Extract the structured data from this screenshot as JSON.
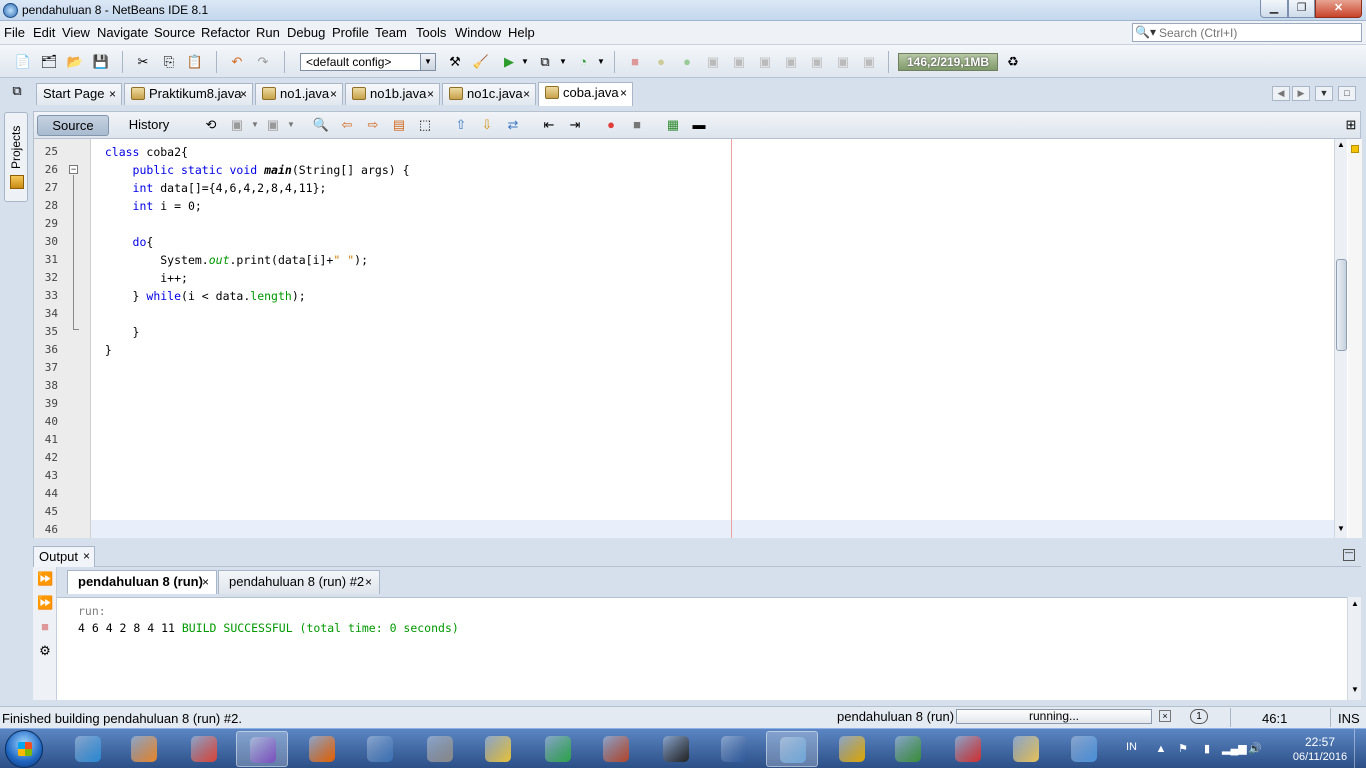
{
  "window": {
    "title": "pendahuluan 8 - NetBeans IDE 8.1"
  },
  "menu": [
    "File",
    "Edit",
    "View",
    "Navigate",
    "Source",
    "Refactor",
    "Run",
    "Debug",
    "Profile",
    "Team",
    "Tools",
    "Window",
    "Help"
  ],
  "search": {
    "placeholder": "Search (Ctrl+I)"
  },
  "toolbar": {
    "config": "<default config>",
    "memory": "146,2/219,1MB"
  },
  "editor_tabs": [
    {
      "label": "Start Page",
      "icon": "none"
    },
    {
      "label": "Praktikum8.java",
      "icon": "java-file-icon"
    },
    {
      "label": "no1.java",
      "icon": "java-file-icon"
    },
    {
      "label": "no1b.java",
      "icon": "java-file-icon"
    },
    {
      "label": "no1c.java",
      "icon": "java-file-icon"
    },
    {
      "label": "coba.java",
      "icon": "java-file-icon",
      "active": true
    }
  ],
  "projects_label": "Projects",
  "editor": {
    "source_tab": "Source",
    "history_tab": "History",
    "line_numbers": [
      "25",
      "26",
      "27",
      "28",
      "29",
      "30",
      "31",
      "32",
      "33",
      "34",
      "35",
      "36",
      "37",
      "38",
      "39",
      "40",
      "41",
      "42",
      "43",
      "44",
      "45",
      "46"
    ],
    "code": {
      "l25_kw": "class",
      "l25_rest": " coba2{",
      "l26_kw": "public static void",
      "l26_name": "main",
      "l26_rest": "(String[] args) {",
      "l27_kw": "int",
      "l27_rest": " data[]={4,6,4,2,8,4,11};",
      "l28_kw": "int",
      "l28_rest": " i = 0;",
      "l30_kw": "do",
      "l30_rest": "{",
      "l31_a": "System.",
      "l31_out": "out",
      "l31_b": ".print(data[i]+",
      "l31_str": "\" \"",
      "l31_c": ");",
      "l32": "i++;",
      "l33_a": "} ",
      "l33_kw": "while",
      "l33_b": "(i < data.",
      "l33_fld": "length",
      "l33_c": ");",
      "l35": "}",
      "l36": "}"
    }
  },
  "output": {
    "tab_label": "Output",
    "run_tabs": [
      "pendahuluan 8 (run)",
      "pendahuluan 8 (run) #2"
    ],
    "lines": {
      "run": "run:",
      "result": "4 6 4 2 8 4 11 ",
      "build": "BUILD SUCCESSFUL (total time: 0 seconds)"
    }
  },
  "status": {
    "message": "Finished building pendahuluan 8 (run) #2.",
    "process": "pendahuluan 8 (run)",
    "progress": "running...",
    "notifications": "1",
    "caret": "46:1",
    "mode": "INS"
  },
  "taskbar": {
    "apps": [
      {
        "name": "ie-icon",
        "color": "#2a8ad4"
      },
      {
        "name": "media-player-icon",
        "color": "#e8862a"
      },
      {
        "name": "chrome-icon",
        "color": "#db4437"
      },
      {
        "name": "visual-studio-icon",
        "color": "#7a4fbf",
        "active": true
      },
      {
        "name": "firefox-icon",
        "color": "#e66000"
      },
      {
        "name": "document-viewer-icon",
        "color": "#3a6fb3"
      },
      {
        "name": "camera-icon",
        "color": "#888888"
      },
      {
        "name": "disc-icon",
        "color": "#e8c33a"
      },
      {
        "name": "vector-icon",
        "color": "#2ca44a"
      },
      {
        "name": "winrar-icon",
        "color": "#b3452a"
      },
      {
        "name": "webcam-icon",
        "color": "#222222"
      },
      {
        "name": "word-icon",
        "color": "#2b579a"
      },
      {
        "name": "netbeans-icon",
        "color": "#6ea7d8",
        "active": true
      },
      {
        "name": "autocad-icon",
        "color": "#e0a800"
      },
      {
        "name": "spreadsheet-icon",
        "color": "#3a8f3a"
      },
      {
        "name": "recorder-icon",
        "color": "#d03030"
      },
      {
        "name": "explorer-icon",
        "color": "#e8c35a"
      },
      {
        "name": "paint-icon",
        "color": "#4a90d9"
      }
    ],
    "lang": "IN",
    "time": "22:57",
    "date": "06/11/2016"
  }
}
